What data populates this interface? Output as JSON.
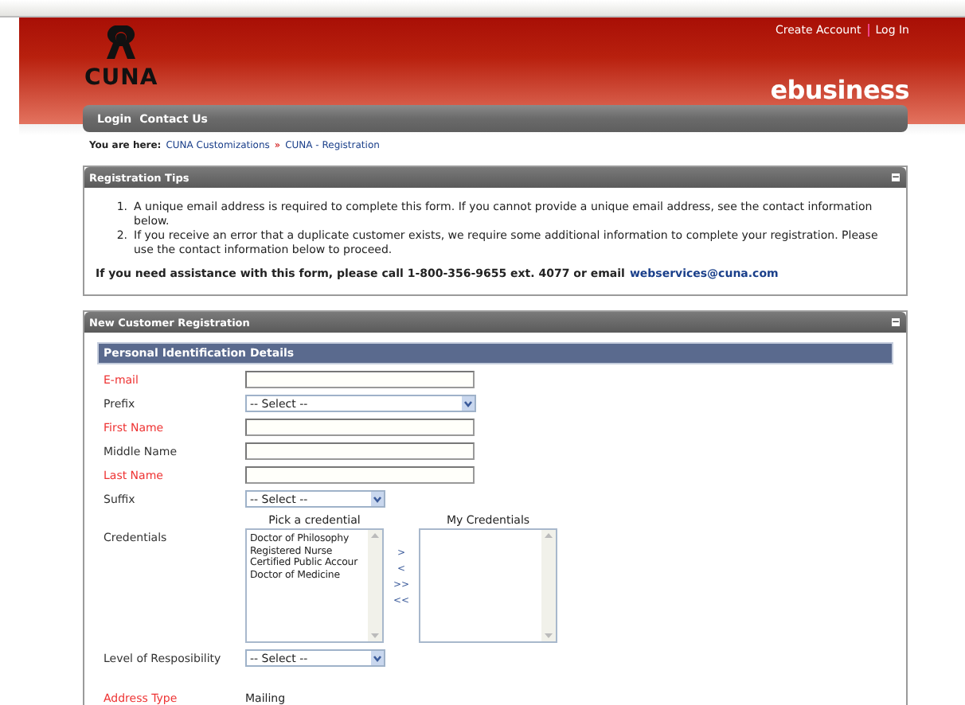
{
  "header": {
    "logo_text": "CUNA",
    "account_links": [
      {
        "label": "Create Account"
      },
      {
        "label": "Log In"
      }
    ],
    "brand": "ebusiness"
  },
  "nav": [
    {
      "label": "Login"
    },
    {
      "label": "Contact Us"
    }
  ],
  "breadcrumb": {
    "label": "You are here:",
    "items": [
      "CUNA Customizations",
      "CUNA - Registration"
    ],
    "separator": "»"
  },
  "tips_panel": {
    "title": "Registration Tips",
    "collapse_icon": "−",
    "tips": [
      {
        "number": "1.",
        "text": "A unique email address is required to complete this form. If you cannot provide a unique email address, see the contact information below."
      },
      {
        "number": "2.",
        "text": "If you receive an error that a duplicate customer exists, we require some additional information to complete your registration. Please use the contact information below to proceed."
      }
    ],
    "assistance": "If you need assistance with this form, please call 1-800-356-9655 ext. 4077 or email",
    "email_link": "webservices@cuna.com"
  },
  "registration_panel": {
    "title": "New Customer Registration",
    "collapse_icon": "−",
    "section": "Personal Identification Details",
    "fields": [
      {
        "kind": "text",
        "label": "E-mail",
        "required": true
      },
      {
        "kind": "select",
        "label": "Prefix",
        "required": false,
        "value": "-- Select --",
        "wide": true
      },
      {
        "kind": "text",
        "label": "First Name",
        "required": true
      },
      {
        "kind": "text",
        "label": "Middle Name",
        "required": false
      },
      {
        "kind": "text",
        "label": "Last Name",
        "required": true
      },
      {
        "kind": "select",
        "label": "Suffix",
        "required": false,
        "value": "-- Select --",
        "wide": false
      },
      {
        "kind": "credentials",
        "label": "Credentials",
        "required": false,
        "available_label": "Pick a credential",
        "available": [
          "Doctor of Philosophy",
          "Registered Nurse",
          "Certified Public Accour",
          "Doctor of Medicine"
        ],
        "chosen_label": "My Credentials",
        "move_buttons": [
          ">",
          "<",
          ">>",
          "<<"
        ]
      },
      {
        "kind": "select",
        "label": "Level of Resposibility",
        "required": false,
        "value": "-- Select --",
        "wide": false
      },
      {
        "kind": "static",
        "label": "Address Type",
        "required": true,
        "value": "Mailing"
      }
    ]
  }
}
